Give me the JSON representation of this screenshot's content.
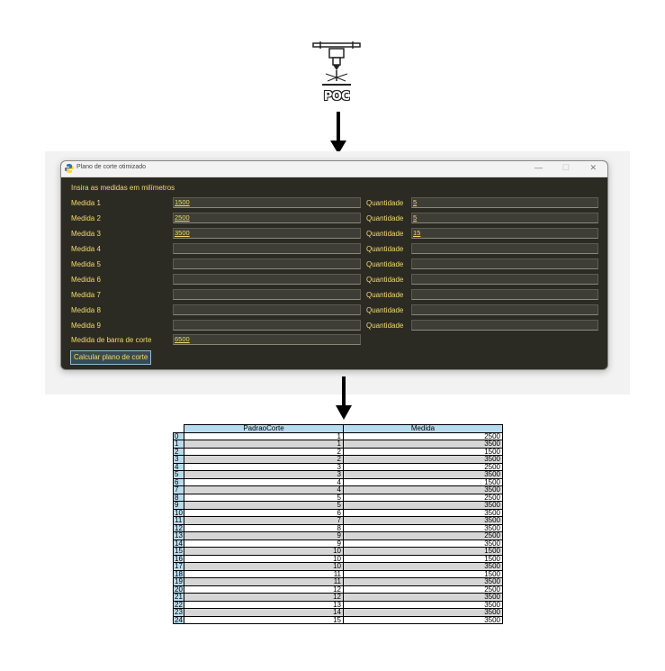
{
  "logo": {
    "text": "POC",
    "icon": "laser-cutter-icon"
  },
  "window": {
    "title": "Plano de corte otimizado",
    "controls": {
      "minimize": "—",
      "maximize": "☐",
      "close": "✕"
    },
    "header": "Insira as medidas em milímetros",
    "rows": [
      {
        "label": "Medida 1",
        "value": "1500",
        "qty_label": "Quantidade",
        "qty": "5"
      },
      {
        "label": "Medida 2",
        "value": "2500",
        "qty_label": "Quantidade",
        "qty": "5"
      },
      {
        "label": "Medida 3",
        "value": "3500",
        "qty_label": "Quantidade",
        "qty": "15"
      },
      {
        "label": "Medida 4",
        "value": "",
        "qty_label": "Quantidade",
        "qty": ""
      },
      {
        "label": "Medida 5",
        "value": "",
        "qty_label": "Quantidade",
        "qty": ""
      },
      {
        "label": "Medida 6",
        "value": "",
        "qty_label": "Quantidade",
        "qty": ""
      },
      {
        "label": "Medida 7",
        "value": "",
        "qty_label": "Quantidade",
        "qty": ""
      },
      {
        "label": "Medida 8",
        "value": "",
        "qty_label": "Quantidade",
        "qty": ""
      },
      {
        "label": "Medida 9",
        "value": "",
        "qty_label": "Quantidade",
        "qty": ""
      }
    ],
    "bar_label": "Medida de barra de corte",
    "bar_value": "6500",
    "button": "Calcular plano de corte"
  },
  "colors": {
    "window_bg": "#2b2b23",
    "label": "#f5d96a",
    "header_cell": "#b8dcef",
    "alt_row": "#d6d6d6"
  },
  "table": {
    "headers": [
      "PadraoCorte",
      "Medida"
    ],
    "rows": [
      [
        "0",
        "1",
        "2500"
      ],
      [
        "1",
        "1",
        "3500"
      ],
      [
        "2",
        "2",
        "1500"
      ],
      [
        "3",
        "2",
        "3500"
      ],
      [
        "4",
        "3",
        "2500"
      ],
      [
        "5",
        "3",
        "3500"
      ],
      [
        "6",
        "4",
        "1500"
      ],
      [
        "7",
        "4",
        "3500"
      ],
      [
        "8",
        "5",
        "2500"
      ],
      [
        "9",
        "5",
        "3500"
      ],
      [
        "10",
        "6",
        "3500"
      ],
      [
        "11",
        "7",
        "3500"
      ],
      [
        "12",
        "8",
        "3500"
      ],
      [
        "13",
        "9",
        "2500"
      ],
      [
        "14",
        "9",
        "3500"
      ],
      [
        "15",
        "10",
        "1500"
      ],
      [
        "16",
        "10",
        "1500"
      ],
      [
        "17",
        "10",
        "3500"
      ],
      [
        "18",
        "11",
        "1500"
      ],
      [
        "19",
        "11",
        "3500"
      ],
      [
        "20",
        "12",
        "2500"
      ],
      [
        "21",
        "12",
        "3500"
      ],
      [
        "22",
        "13",
        "3500"
      ],
      [
        "23",
        "14",
        "3500"
      ],
      [
        "24",
        "15",
        "3500"
      ]
    ]
  }
}
